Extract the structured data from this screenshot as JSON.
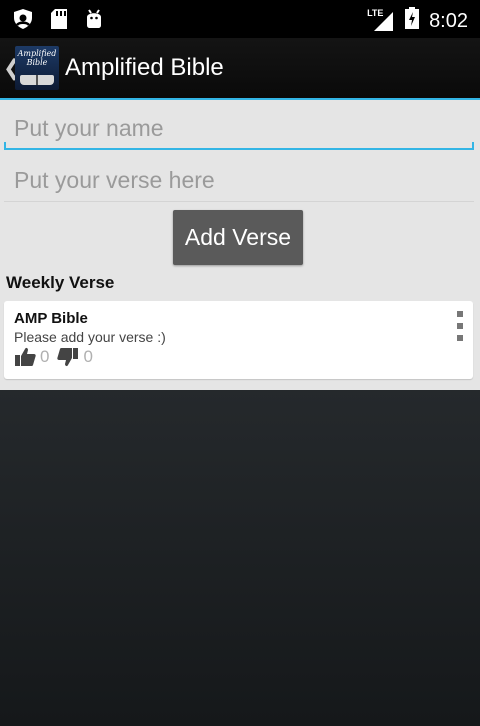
{
  "status_bar": {
    "time": "8:02",
    "network": "LTE",
    "icons": [
      "shield-icon",
      "sd-card-icon",
      "android-icon",
      "signal-icon",
      "battery-charging-icon"
    ]
  },
  "action_bar": {
    "title": "Amplified Bible",
    "logo_text": "Amplified Bible"
  },
  "form": {
    "name_placeholder": "Put your name",
    "verse_placeholder": "Put your verse here",
    "name_value": "",
    "verse_value": "",
    "add_button": "Add Verse"
  },
  "weekly": {
    "title": "Weekly Verse",
    "card": {
      "title": "AMP Bible",
      "body": "Please add your verse :)",
      "likes": "0",
      "dislikes": "0"
    }
  },
  "colors": {
    "accent": "#33b5e5",
    "content_bg": "#e5e5e5",
    "button_bg": "#5a5a5a"
  }
}
